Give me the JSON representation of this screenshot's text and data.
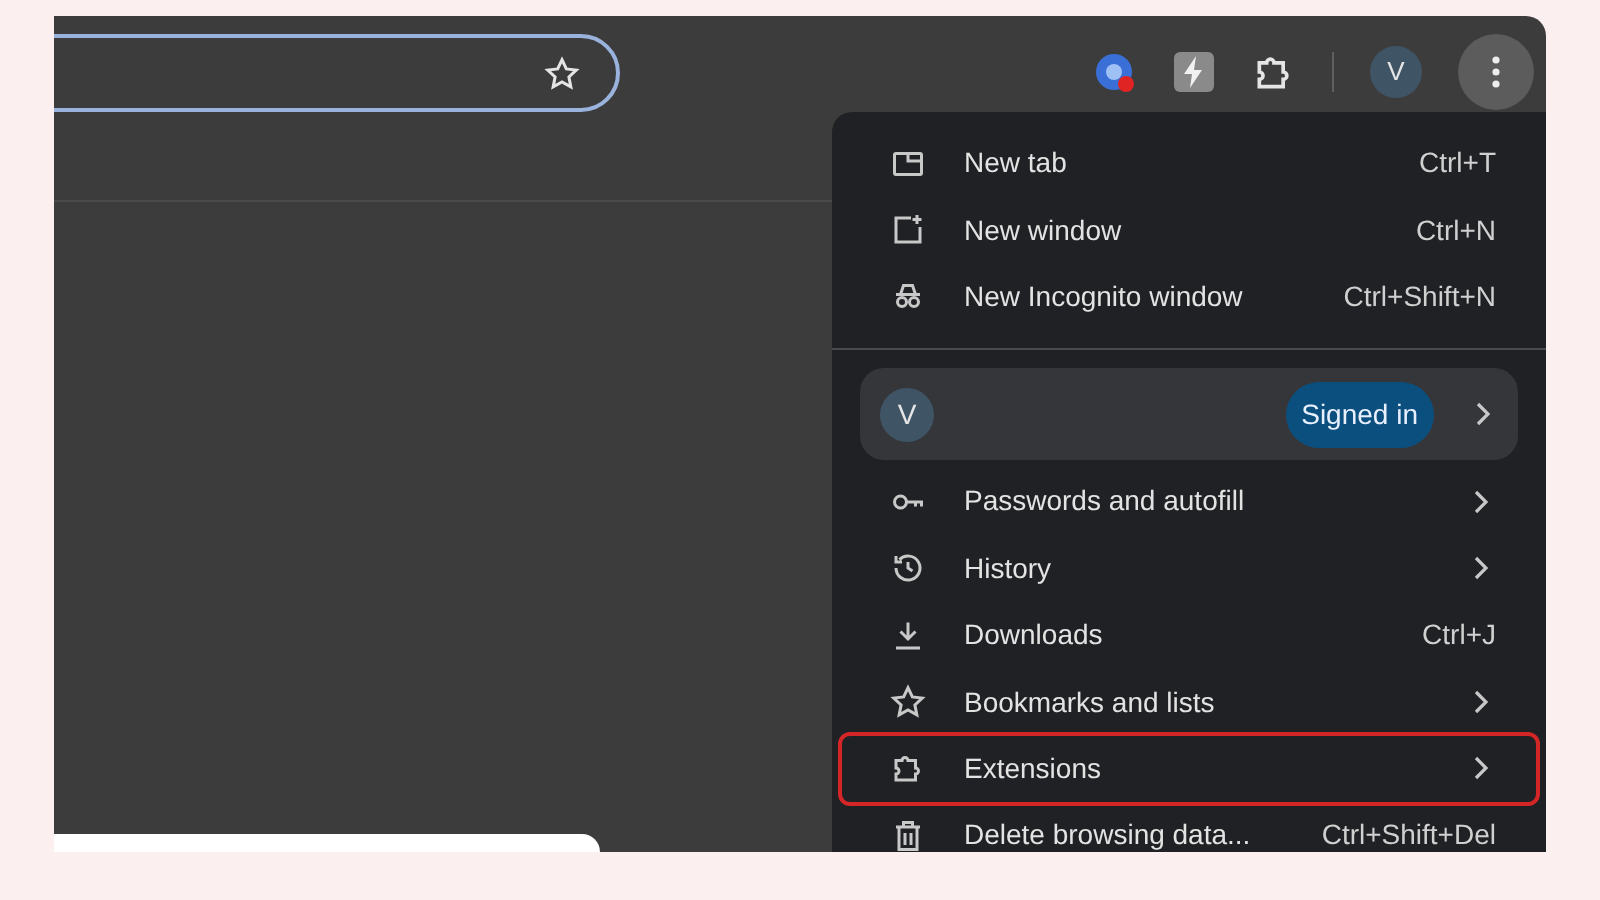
{
  "toolbar": {
    "avatar": "V"
  },
  "menu": {
    "items": [
      {
        "kind": "item",
        "label": "New tab",
        "shortcut": "Ctrl+T",
        "submenu": false,
        "highlighted": false
      },
      {
        "kind": "item",
        "label": "New window",
        "shortcut": "Ctrl+N",
        "submenu": false,
        "highlighted": false
      },
      {
        "kind": "item",
        "label": "New Incognito window",
        "shortcut": "Ctrl+Shift+N",
        "submenu": false,
        "highlighted": false
      },
      {
        "kind": "divider"
      },
      {
        "kind": "profile",
        "avatar": "V",
        "badge": "Signed in",
        "submenu": true,
        "highlighted": false
      },
      {
        "kind": "item",
        "label": "Passwords and autofill",
        "submenu": true,
        "highlighted": false
      },
      {
        "kind": "item",
        "label": "History",
        "submenu": true,
        "highlighted": false
      },
      {
        "kind": "item",
        "label": "Downloads",
        "shortcut": "Ctrl+J",
        "submenu": false,
        "highlighted": false
      },
      {
        "kind": "item",
        "label": "Bookmarks and lists",
        "submenu": true,
        "highlighted": false
      },
      {
        "kind": "item",
        "label": "Extensions",
        "submenu": true,
        "highlighted": true
      },
      {
        "kind": "item",
        "label": "Delete browsing data...",
        "shortcut": "Ctrl+Shift+Del",
        "submenu": false,
        "highlighted": false
      }
    ]
  }
}
